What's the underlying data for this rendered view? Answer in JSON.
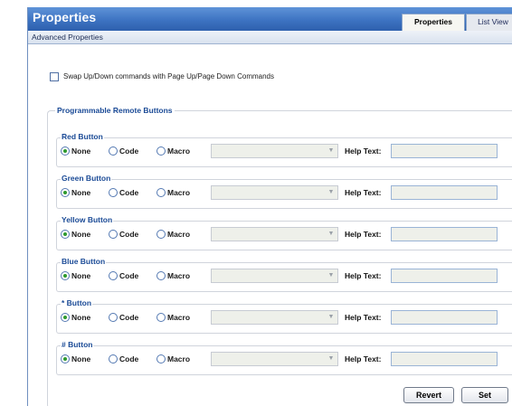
{
  "window": {
    "title": "Properties",
    "tabs": [
      {
        "label": "Properties",
        "active": true
      },
      {
        "label": "List View",
        "active": false
      }
    ],
    "subtitle": "Advanced Properties"
  },
  "swap": {
    "label": "Swap Up/Down commands with Page Up/Page Down Commands",
    "checked": false
  },
  "remote": {
    "group_label": "Programmable Remote Buttons",
    "option_labels": {
      "none": "None",
      "code": "Code",
      "macro": "Macro"
    },
    "help_label": "Help Text:",
    "buttons": [
      {
        "label": "Red Button",
        "selected": "None",
        "help_text": ""
      },
      {
        "label": "Green Button",
        "selected": "None",
        "help_text": ""
      },
      {
        "label": "Yellow Button",
        "selected": "None",
        "help_text": ""
      },
      {
        "label": "Blue Button",
        "selected": "None",
        "help_text": ""
      },
      {
        "label": "* Button",
        "selected": "None",
        "help_text": ""
      },
      {
        "label": "# Button",
        "selected": "None",
        "help_text": ""
      }
    ]
  },
  "actions": {
    "revert_label": "Revert",
    "set_label": "Set"
  },
  "colors": {
    "title_bar": "#3d73c2",
    "legend_text": "#1a4a96",
    "radio_checked": "#2e9a2e"
  },
  "icons": {
    "radio_checked": "radio-checked-icon",
    "dropdown_arrow": "chevron-down-icon"
  }
}
